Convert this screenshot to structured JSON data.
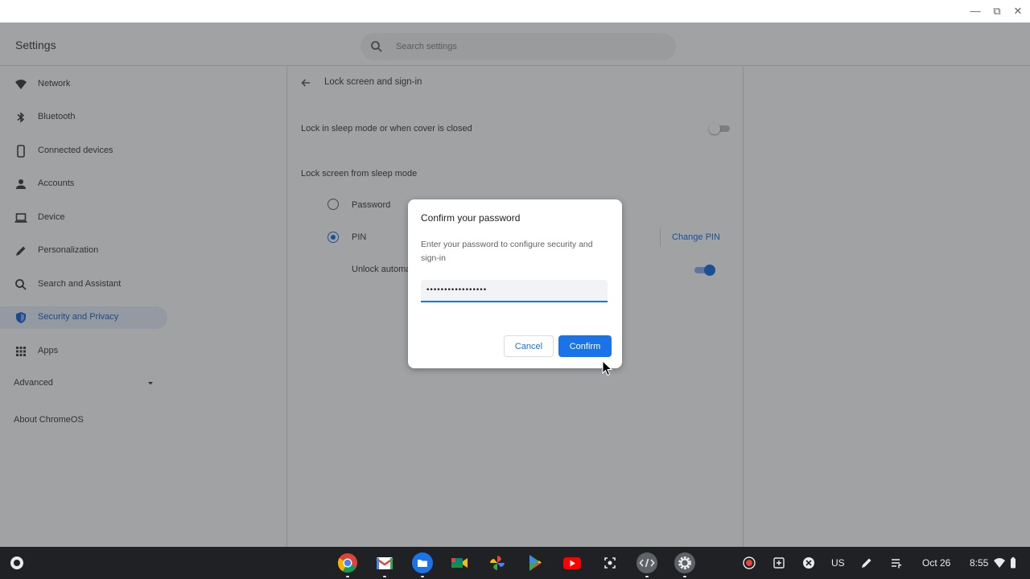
{
  "window": {
    "controls": {
      "minimize": "—",
      "maximize": "⧉",
      "close": "✕"
    }
  },
  "header": {
    "app_title": "Settings",
    "search_placeholder": "Search settings"
  },
  "sidebar": {
    "items": [
      {
        "label": "Network",
        "icon": "wifi-icon"
      },
      {
        "label": "Bluetooth",
        "icon": "bluetooth-icon"
      },
      {
        "label": "Connected devices",
        "icon": "phone-icon"
      },
      {
        "label": "Accounts",
        "icon": "person-icon"
      },
      {
        "label": "Device",
        "icon": "laptop-icon"
      },
      {
        "label": "Personalization",
        "icon": "pencil-icon"
      },
      {
        "label": "Search and Assistant",
        "icon": "search-icon"
      },
      {
        "label": "Security and Privacy",
        "icon": "shield-icon",
        "active": true
      },
      {
        "label": "Apps",
        "icon": "grid-icon"
      }
    ],
    "advanced_label": "Advanced",
    "about_label": "About ChromeOS"
  },
  "content": {
    "page_title": "Lock screen and sign-in",
    "lock_sleep_label": "Lock in sleep mode or when cover is closed",
    "lock_sleep_enabled": false,
    "lock_from_sleep_heading": "Lock screen from sleep mode",
    "options": [
      {
        "label": "Password",
        "selected": false
      },
      {
        "label": "PIN",
        "selected": true
      }
    ],
    "change_pin_label": "Change PIN",
    "unlock_label": "Unlock automa",
    "unlock_enabled": true
  },
  "dialog": {
    "title": "Confirm your password",
    "body": "Enter your password to configure security and sign-in",
    "password_value": "•••••••••••••••••",
    "cancel_label": "Cancel",
    "confirm_label": "Confirm"
  },
  "shelf": {
    "apps": [
      "chrome-icon",
      "gmail-icon",
      "files-icon",
      "meet-icon",
      "photos-icon",
      "play-store-icon",
      "youtube-icon",
      "screen-capture-icon",
      "terminal-icon",
      "settings-icon"
    ],
    "keyboard_layout": "US",
    "date": "Oct 26",
    "time": "8:55"
  },
  "colors": {
    "accent": "#1a73e8",
    "active_nav_bg": "#e8f0fe",
    "shelf_bg": "#202124"
  }
}
